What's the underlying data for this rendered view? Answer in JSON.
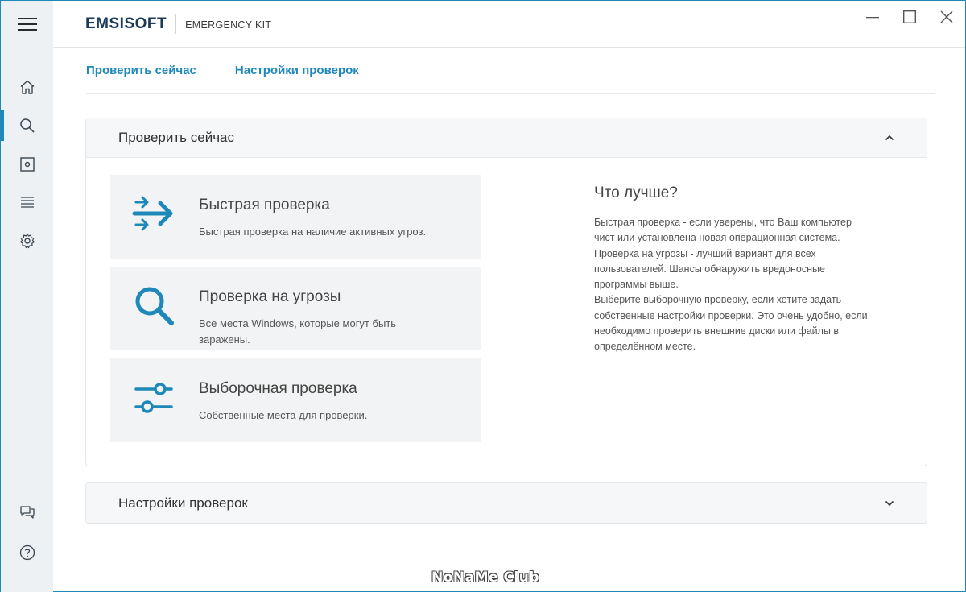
{
  "brand": {
    "logo": "EMSISOFT",
    "product": "EMERGENCY KIT"
  },
  "tabs": [
    {
      "label": "Проверить сейчас"
    },
    {
      "label": "Настройки проверок"
    }
  ],
  "sidebar": {
    "items": [
      {
        "icon": "home-icon"
      },
      {
        "icon": "search-icon",
        "active": true
      },
      {
        "icon": "quarantine-icon"
      },
      {
        "icon": "logs-icon"
      },
      {
        "icon": "gear-icon"
      },
      {
        "icon": "chat-icon"
      },
      {
        "icon": "help-icon"
      }
    ]
  },
  "scan_panel": {
    "title": "Проверить сейчас",
    "cards": [
      {
        "title": "Быстрая проверка",
        "desc": "Быстрая проверка на наличие активных угроз.",
        "icon": "quick-scan-arrows-icon"
      },
      {
        "title": "Проверка на угрозы",
        "desc": "Все места Windows, которые могут быть заражены.",
        "icon": "magnifier-icon"
      },
      {
        "title": "Выборочная проверка",
        "desc": "Собственные места для проверки.",
        "icon": "sliders-icon"
      }
    ],
    "info": {
      "title": "Что лучше?",
      "lines": [
        "Быстрая проверка - если уверены, что Ваш компьютер",
        "чист или установлена новая операционная система.",
        "Проверка на угрозы - лучший вариант для всех",
        "пользователей. Шансы обнаружить вредоносные",
        "программы выше.",
        "Выберите выборочную проверку, если хотите задать",
        "собственные настройки проверки. Это очень удобно, если",
        "необходимо проверить внешние диски или файлы в",
        "определённом месте."
      ]
    }
  },
  "settings_panel": {
    "title": "Настройки проверок"
  },
  "watermark": "NoNaMe Club",
  "colors": {
    "accent": "#1e88b8",
    "sidebar_bg": "#eef1f4",
    "card_bg": "#f2f3f4",
    "brand_dark": "#1b3a57"
  }
}
